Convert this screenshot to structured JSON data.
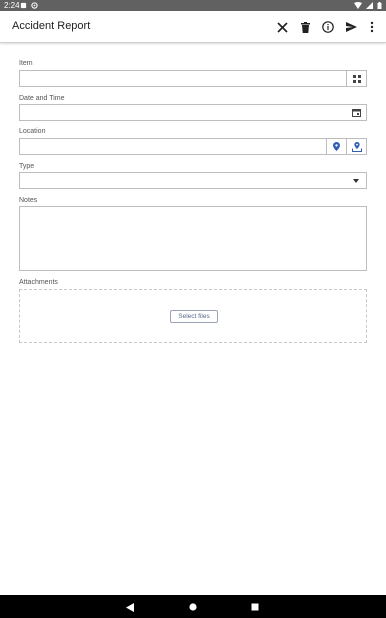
{
  "status_bar": {
    "time": "2:24"
  },
  "app_bar": {
    "title": "Accident Report",
    "actions": [
      "close-icon",
      "delete-icon",
      "info-icon",
      "send-icon",
      "more-vert-icon"
    ]
  },
  "form": {
    "item": {
      "label": "Item",
      "value": "",
      "icon": "barcode-scan-icon"
    },
    "date_time": {
      "label": "Date and Time",
      "value": "",
      "icon": "calendar-icon"
    },
    "location": {
      "label": "Location",
      "value": "",
      "icons": [
        "map-pin-icon",
        "map-pin-upload-icon"
      ]
    },
    "type": {
      "label": "Type",
      "value": "",
      "icon": "chevron-down-icon"
    },
    "notes": {
      "label": "Notes",
      "value": ""
    },
    "attachments": {
      "label": "Attachments",
      "button_label": "Select files"
    }
  },
  "colors": {
    "accent": "#2f5fb3",
    "status_bar": "#616161",
    "nav_bar": "#000000"
  }
}
